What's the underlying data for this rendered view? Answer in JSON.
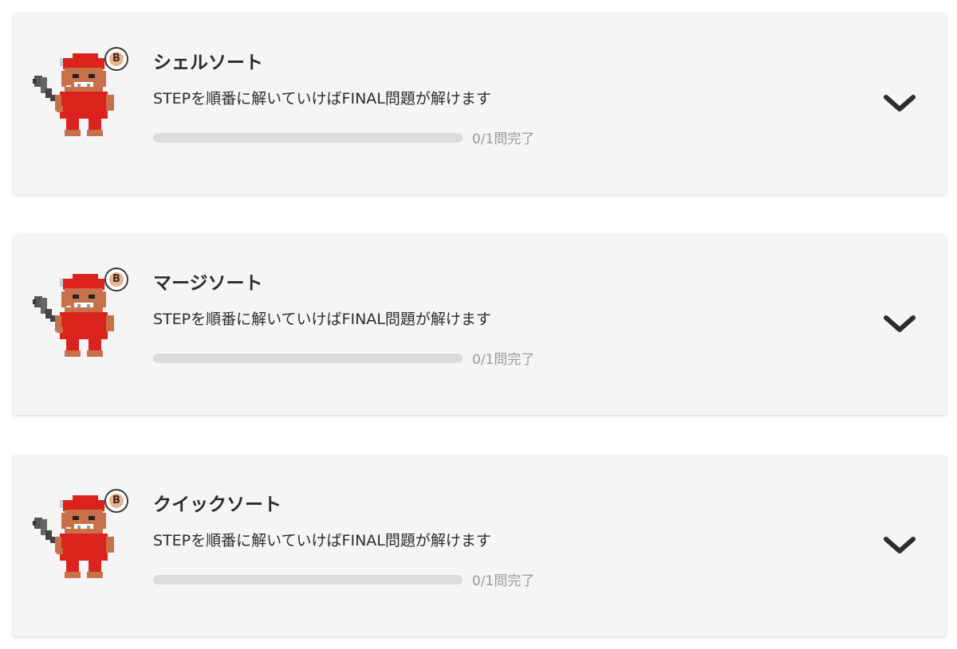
{
  "courses": [
    {
      "title": "シェルソート",
      "description": "STEPを順番に解いていけばFINAL問題が解けます",
      "progress_text": "0/1問完了",
      "progress_fraction": 0,
      "rank": "B",
      "avatar_icon": "red-oni-character-icon",
      "expand_icon": "chevron-down-icon"
    },
    {
      "title": "マージソート",
      "description": "STEPを順番に解いていけばFINAL問題が解けます",
      "progress_text": "0/1問完了",
      "progress_fraction": 0,
      "rank": "B",
      "avatar_icon": "red-oni-character-icon",
      "expand_icon": "chevron-down-icon"
    },
    {
      "title": "クイックソート",
      "description": "STEPを順番に解いていけばFINAL問題が解けます",
      "progress_text": "0/1問完了",
      "progress_fraction": 0,
      "rank": "B",
      "avatar_icon": "red-oni-character-icon",
      "expand_icon": "chevron-down-icon"
    }
  ],
  "colors": {
    "card_background": "#f5f5f5",
    "progress_track": "#dcdcdc",
    "title_text": "#2c2c2c",
    "muted_text": "#9a9a9a",
    "character_red": "#d9231c",
    "character_skin": "#c8704a",
    "rank_badge": "#e9b48c"
  }
}
